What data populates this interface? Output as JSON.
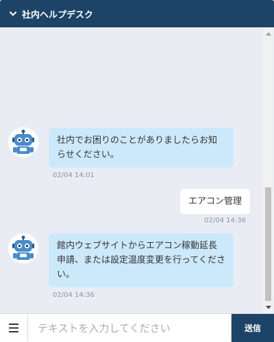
{
  "header": {
    "title": "社内ヘルプデスク",
    "collapse_icon": "chevron-down-icon"
  },
  "messages": [
    {
      "sender": "bot",
      "text": "社内でお困りのことがありましたらお知らせください。",
      "time": "02/04 14:01"
    },
    {
      "sender": "user",
      "text": "エアコン管理",
      "time": "02/04 14:36"
    },
    {
      "sender": "bot",
      "text": "館内ウェブサイトからエアコン稼動延長申請、または設定温度変更を行ってください。",
      "time": "02/04 14:36"
    }
  ],
  "input": {
    "placeholder": "テキストを入力してください",
    "value": ""
  },
  "send_button": {
    "label": "送信"
  },
  "colors": {
    "primary": "#1d4466",
    "bot_bubble": "#cce9fb",
    "chat_background": "#e9edf3"
  }
}
